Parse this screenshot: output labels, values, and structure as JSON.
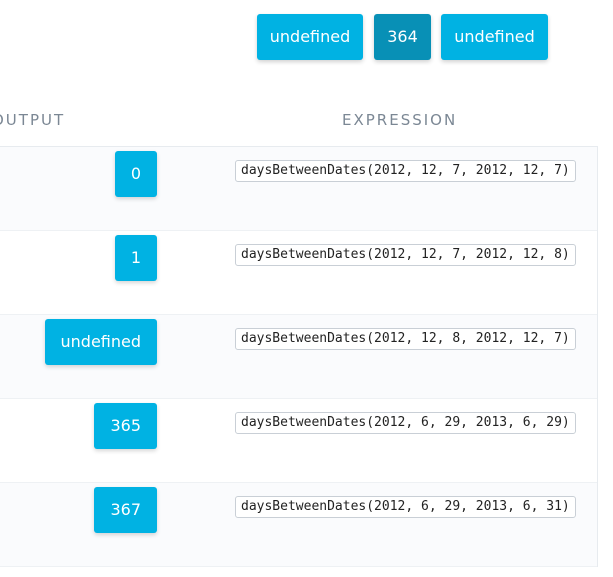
{
  "top_controls": {
    "buttons": [
      {
        "label": "undefined"
      },
      {
        "label": "364"
      },
      {
        "label": "undefined"
      }
    ]
  },
  "table": {
    "headers": {
      "output": "OUTPUT",
      "expression": "EXPRESSION"
    },
    "rows": [
      {
        "output": "0",
        "expression": "daysBetweenDates(2012, 12, 7, 2012, 12, 7)"
      },
      {
        "output": "1",
        "expression": "daysBetweenDates(2012, 12, 7, 2012, 12, 8)"
      },
      {
        "output": "undefined",
        "expression": "daysBetweenDates(2012, 12, 8, 2012, 12, 7)"
      },
      {
        "output": "365",
        "expression": "daysBetweenDates(2012, 6, 29, 2013, 6, 29)"
      },
      {
        "output": "367",
        "expression": "daysBetweenDates(2012, 6, 29, 2013, 6, 31)"
      }
    ]
  },
  "colors": {
    "accent": "#00b2e3",
    "accent_active": "#0890b6",
    "header_text": "#7b8794",
    "row_alt": "#fafbfd"
  }
}
